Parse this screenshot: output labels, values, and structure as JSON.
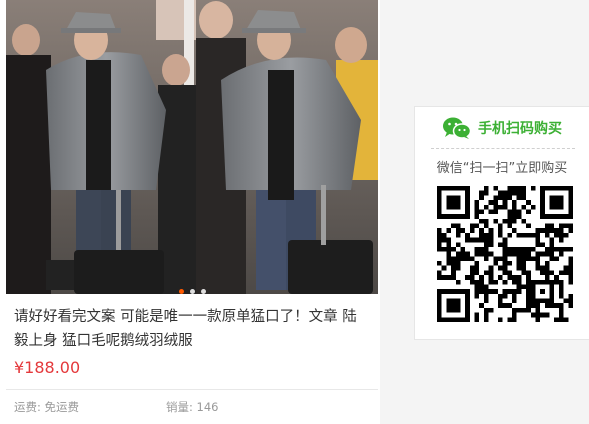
{
  "product": {
    "title": "请好好看完文案 可能是唯一一款原单猛口了！文章 陆毅上身 猛口毛呢鹅绒羽绒服",
    "price": "¥188.00",
    "shipping": "运费: 免运费",
    "sales": "销量: 146",
    "carousel": {
      "count": 3,
      "active_index": 0
    }
  },
  "qr_panel": {
    "heading": "手机扫码购买",
    "subtitle": "微信“扫一扫”立即购买",
    "icon": "wechat-icon"
  },
  "colors": {
    "price": "#e4393c",
    "wechat_green": "#3cb034",
    "carousel_active": "#ff5a00"
  }
}
